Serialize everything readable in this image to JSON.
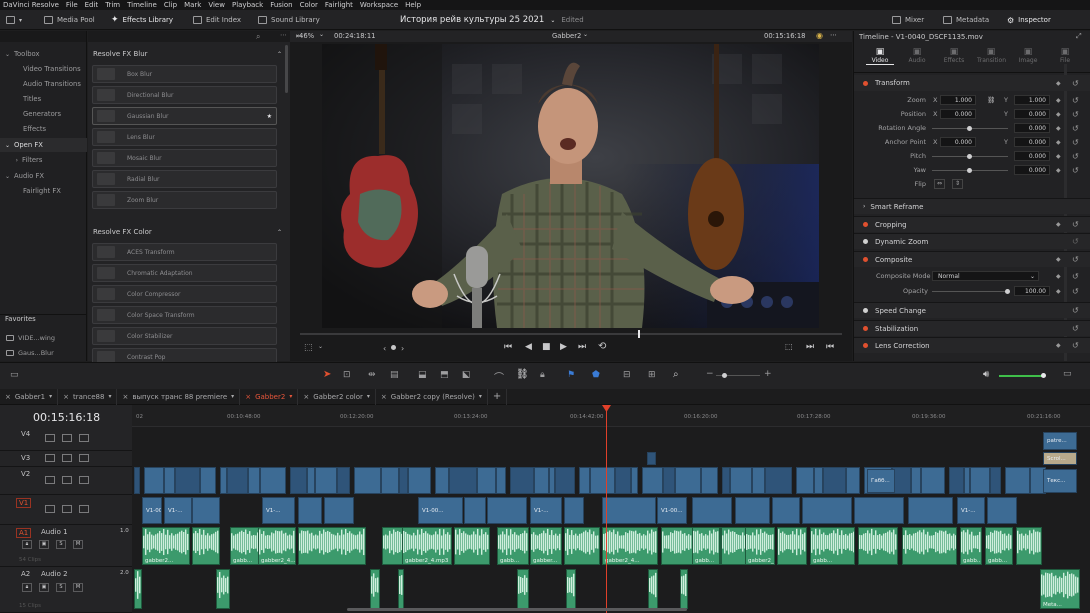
{
  "menu": [
    "DaVinci Resolve",
    "File",
    "Edit",
    "Trim",
    "Timeline",
    "Clip",
    "Mark",
    "View",
    "Playback",
    "Fusion",
    "Color",
    "Fairlight",
    "Workspace",
    "Help"
  ],
  "toolbar": {
    "media_pool": "Media Pool",
    "effects_library": "Effects Library",
    "edit_index": "Edit Index",
    "sound_library": "Sound Library",
    "project_title": "История рейв культуры 25 2021",
    "project_status": "Edited",
    "mixer": "Mixer",
    "metadata": "Metadata",
    "inspector": "Inspector"
  },
  "left_panel": {
    "items": [
      {
        "label": "Toolbox",
        "indent": 0,
        "arrow": "v"
      },
      {
        "label": "Video Transitions",
        "indent": 1
      },
      {
        "label": "Audio Transitions",
        "indent": 1
      },
      {
        "label": "Titles",
        "indent": 1
      },
      {
        "label": "Generators",
        "indent": 1
      },
      {
        "label": "Effects",
        "indent": 1
      },
      {
        "label": "Open FX",
        "indent": 0,
        "arrow": "v",
        "selected": true
      },
      {
        "label": "Filters",
        "indent": 1,
        "arrow": ">"
      },
      {
        "label": "Audio FX",
        "indent": 0,
        "arrow": "v"
      },
      {
        "label": "Fairlight FX",
        "indent": 1
      }
    ],
    "favorites_label": "Favorites",
    "favorites": [
      "VIDE...wing",
      "Gaus...Blur"
    ]
  },
  "fx": {
    "section1": "Resolve FX Blur",
    "blur": [
      "Box Blur",
      "Directional Blur",
      "Gaussian Blur",
      "Lens Blur",
      "Mosaic Blur",
      "Radial Blur",
      "Zoom Blur"
    ],
    "section2": "Resolve FX Color",
    "color": [
      "ACES Transform",
      "Chromatic Adaptation",
      "Color Compressor",
      "Color Space Transform",
      "Color Stabilizer",
      "Contrast Pop"
    ]
  },
  "viewer": {
    "zoom": "46%",
    "src_tc": "00:24:18:11",
    "clip_name": "Gabber2",
    "tc": "00:15:16:18"
  },
  "inspector": {
    "title": "Timeline - V1-0040_DSCF1135.mov",
    "tabs": [
      "Video",
      "Audio",
      "Effects",
      "Transition",
      "Image",
      "File"
    ],
    "transform": "Transform",
    "rows": [
      {
        "label": "Zoom",
        "axis1": "X",
        "v1": "1.000",
        "axis2": "Y",
        "v2": "1.000"
      },
      {
        "label": "Position",
        "axis1": "X",
        "v1": "0.000",
        "axis2": "Y",
        "v2": "0.000"
      },
      {
        "label": "Rotation Angle",
        "v2": "0.000"
      },
      {
        "label": "Anchor Point",
        "axis1": "X",
        "v1": "0.000",
        "axis2": "Y",
        "v2": "0.000"
      },
      {
        "label": "Pitch",
        "v2": "0.000"
      },
      {
        "label": "Yaw",
        "v2": "0.000"
      },
      {
        "label": "Flip"
      }
    ],
    "smart_reframe": "Smart Reframe",
    "cropping": "Cropping",
    "dynamic_zoom": "Dynamic Zoom",
    "composite": "Composite",
    "composite_mode_label": "Composite Mode",
    "composite_mode": "Normal",
    "opacity_label": "Opacity",
    "opacity": "100.00",
    "speed_change": "Speed Change",
    "stabilization": "Stabilization",
    "lens_correction": "Lens Correction"
  },
  "timeline": {
    "tabs": [
      "Gabber1",
      "trance88",
      "выпуск транс 88 premiere",
      "Gabber2",
      "Gabber2 color",
      "Gabber2 copy (Resolve)"
    ],
    "active_tab": 3,
    "timecode": "00:15:16:18",
    "ruler": [
      "02",
      "00:10:48:00",
      "00:12:20:00",
      "00:13:24:00",
      "00:14:42:00",
      "00:16:20:00",
      "00:17:28:00",
      "00:19:36:00",
      "00:21:16:00"
    ],
    "tracks": [
      {
        "id": "V4"
      },
      {
        "id": "V3"
      },
      {
        "id": "V2"
      },
      {
        "id": "V1"
      },
      {
        "id": "A1",
        "name": "Audio 1",
        "ch": "1.0",
        "sub": "54 Clips"
      },
      {
        "id": "A2",
        "name": "Audio 2",
        "ch": "2.0",
        "sub": "15 Clips"
      }
    ],
    "v1_clips": [
      "V1-00...",
      "V1-...",
      "V1-...",
      "V1-00...",
      "V1-...",
      "V1-00...",
      "V1-..."
    ],
    "v2_clips": [
      "Габб...",
      "Текс..."
    ],
    "v3_clips": [
      "Scrol..."
    ],
    "v4_clips": [
      "patre..."
    ],
    "a1_clips": [
      "gabber2...",
      "gabb...",
      "gabber2_4...",
      "gabber2_4.mp3",
      "gabb...",
      "gabber...",
      "gabber2_4...",
      "gabb...",
      "gabber2_1...",
      "gabb...",
      "gabb...",
      "gabb..."
    ],
    "a2_clips": [
      "Meta..."
    ]
  },
  "colors": {
    "accent": "#e7563b",
    "video_clip": "#3d6b94",
    "audio_clip": "#3c9a6c",
    "playhead": "#e0402a"
  }
}
